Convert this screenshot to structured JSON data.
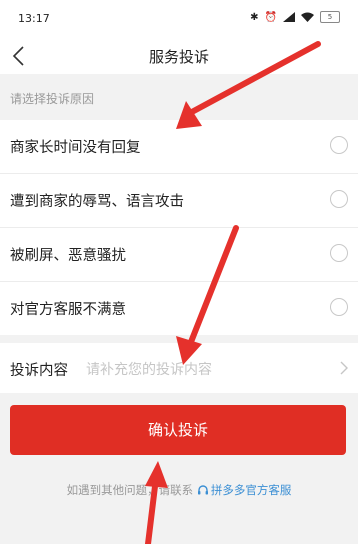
{
  "status_bar": {
    "time": "13:17",
    "battery": "5"
  },
  "nav": {
    "title": "服务投诉"
  },
  "hint": "请选择投诉原因",
  "reasons": [
    {
      "label": "商家长时间没有回复"
    },
    {
      "label": "遭到商家的辱骂、语言攻击"
    },
    {
      "label": "被刷屏、恶意骚扰"
    },
    {
      "label": "对官方客服不满意"
    }
  ],
  "content": {
    "label": "投诉内容",
    "placeholder": "请补充您的投诉内容"
  },
  "submit_label": "确认投诉",
  "footer": {
    "text": "如遇到其他问题，请联系",
    "link": "拼多多官方客服"
  },
  "colors": {
    "accent": "#e02e24",
    "link": "#3b8fd4",
    "annotation_arrow": "#e5312c"
  },
  "icons": [
    "back-arrow-icon",
    "bluetooth-icon",
    "alarm-icon",
    "signal-icon",
    "wifi-icon",
    "battery-icon",
    "chevron-right-icon",
    "headset-icon"
  ]
}
